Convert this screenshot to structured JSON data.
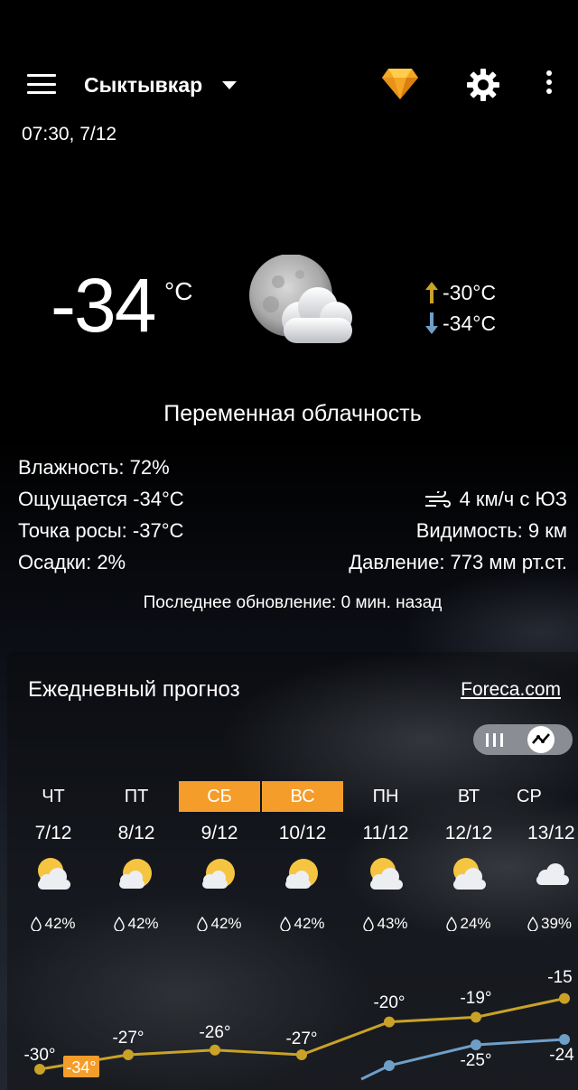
{
  "header": {
    "city": "Сыктывкар",
    "datetime": "07:30, 7/12"
  },
  "current": {
    "temperature": "-34",
    "unit": "°C",
    "high": "-30°C",
    "low": "-34°C",
    "condition": "Переменная облачность",
    "icon": "moon-partly-cloudy-icon"
  },
  "details": {
    "humidity": "Влажность: 72%",
    "feels_like": "Ощущается -34°C",
    "dew_point": "Точка росы: -37°C",
    "precipitation": "Осадки: 2%",
    "wind": "4 км/ч с ЮЗ",
    "visibility": "Видимость: 9 км",
    "pressure": "Давление: 773 мм рт.ст."
  },
  "last_update": "Последнее обновление: 0 мин. назад",
  "forecast": {
    "title": "Ежедневный прогноз",
    "provider": "Foreca.com",
    "days": [
      {
        "name": "ЧТ",
        "date": "7/12",
        "precip": "42%",
        "highlight": false
      },
      {
        "name": "ПТ",
        "date": "8/12",
        "precip": "42%",
        "highlight": false
      },
      {
        "name": "СБ",
        "date": "9/12",
        "precip": "42%",
        "highlight": true
      },
      {
        "name": "ВС",
        "date": "10/12",
        "precip": "42%",
        "highlight": true
      },
      {
        "name": "ПН",
        "date": "11/12",
        "precip": "43%",
        "highlight": false
      },
      {
        "name": "ВТ",
        "date": "12/12",
        "precip": "24%",
        "highlight": false
      },
      {
        "name": "СР",
        "date": "13/12",
        "precip": "39%",
        "highlight": false
      }
    ],
    "high_labels": [
      "-30°",
      "-27°",
      "-26°",
      "-27°",
      "-20°",
      "-19°",
      "-15"
    ],
    "high_values": [
      -30,
      -27,
      -26,
      -27,
      -20,
      -19,
      -15
    ],
    "low_labels": [
      "-34°",
      "-25°",
      "-24"
    ],
    "low_values": [
      -34,
      null,
      null,
      null,
      -29,
      -25,
      -24
    ]
  },
  "colors": {
    "accent": "#f59d2a",
    "high_line": "#c9a227",
    "low_line": "#6f9fc7"
  }
}
